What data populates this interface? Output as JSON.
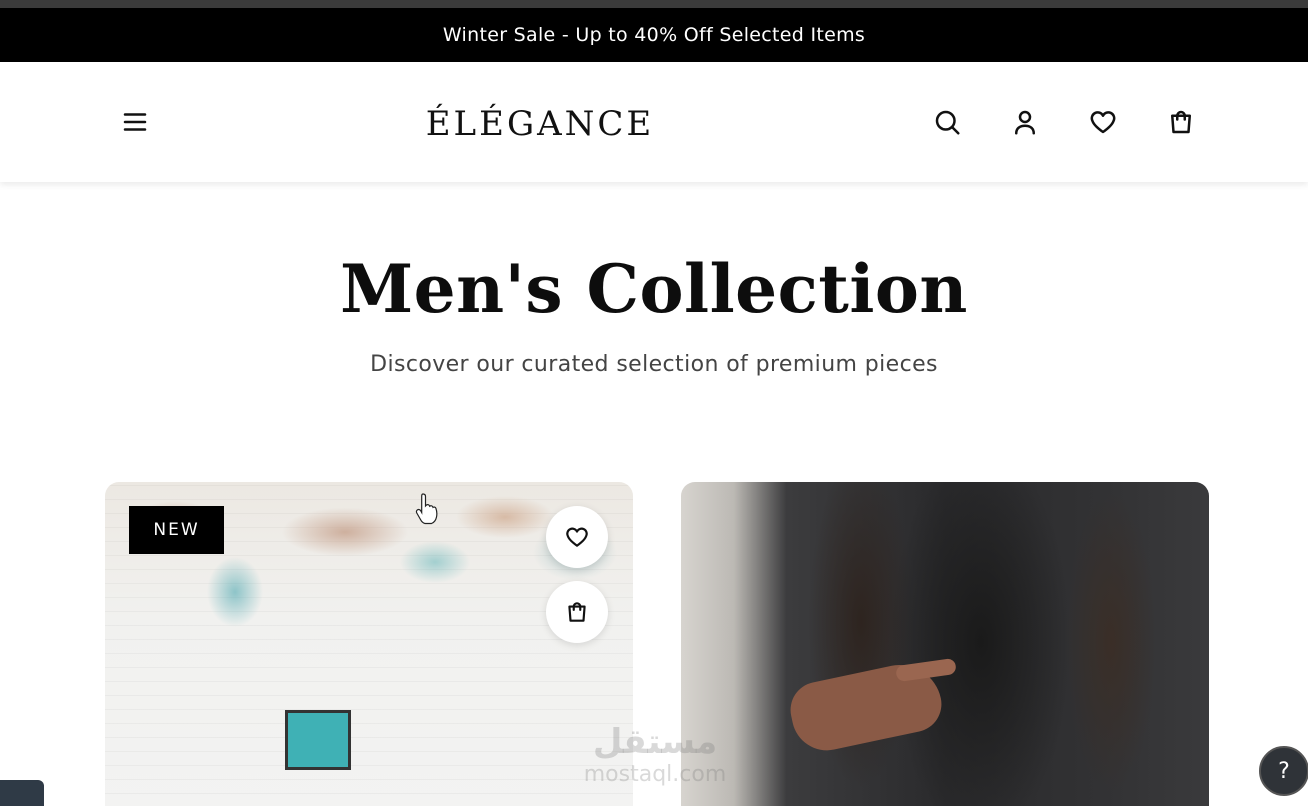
{
  "announcement": {
    "text": "Winter Sale - Up to 40% Off Selected Items"
  },
  "header": {
    "logo": "ÉLÉGANCE",
    "icons": {
      "menu": "menu-icon",
      "search": "search-icon",
      "account": "user-icon",
      "wishlist": "heart-icon",
      "cart": "shopping-bag-icon"
    }
  },
  "hero": {
    "title": "Men's Collection",
    "subtitle": "Discover our curated selection of premium pieces"
  },
  "products": [
    {
      "badge": "NEW",
      "actions": [
        "heart-icon",
        "shopping-bag-icon"
      ]
    },
    {
      "badge": ""
    }
  ],
  "watermark": {
    "arabic": "مستقل",
    "latin": "mostaql.com"
  },
  "help": {
    "label": "?"
  },
  "colors": {
    "announcement_bg": "#000000",
    "text": "#111111",
    "help_bg": "#2f3338"
  }
}
